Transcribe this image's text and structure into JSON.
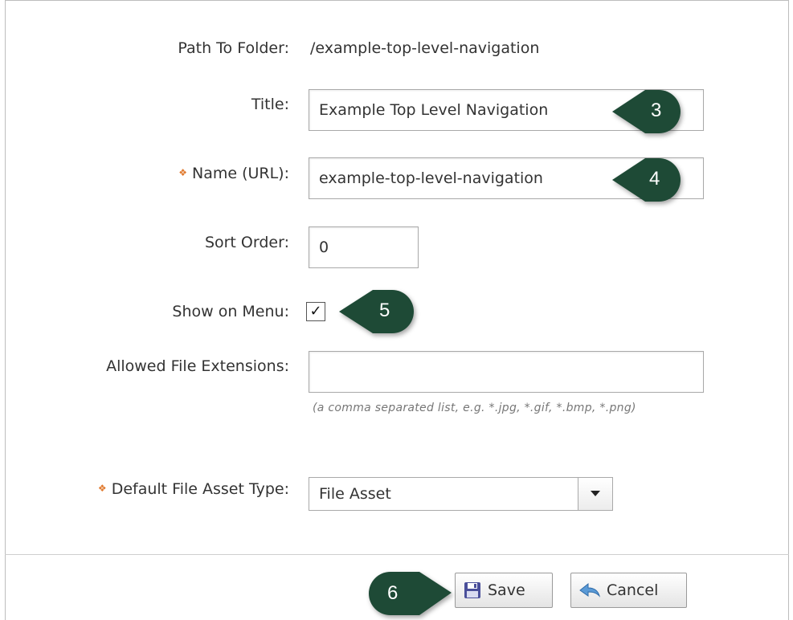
{
  "form": {
    "path_label": "Path To Folder:",
    "path_value": "/example-top-level-navigation",
    "title_label": "Title:",
    "title_value": "Example Top Level Navigation",
    "name_label": "Name (URL):",
    "name_value": "example-top-level-navigation",
    "sort_label": "Sort Order:",
    "sort_value": "0",
    "menu_label": "Show on Menu:",
    "menu_checked": true,
    "ext_label": "Allowed File Extensions:",
    "ext_value": "",
    "ext_hint": "(a comma separated list, e.g. *.jpg, *.gif, *.bmp, *.png)",
    "asset_label": "Default File Asset Type:",
    "asset_value": "File Asset",
    "required_marker": "❖"
  },
  "buttons": {
    "save": "Save",
    "cancel": "Cancel"
  },
  "callouts": {
    "title": "3",
    "name": "4",
    "menu": "5",
    "save": "6",
    "color": "#1e4a36"
  },
  "icons": {
    "save": "floppy-disk-icon",
    "cancel": "back-arrow-icon",
    "dropdown": "caret-down-icon"
  }
}
